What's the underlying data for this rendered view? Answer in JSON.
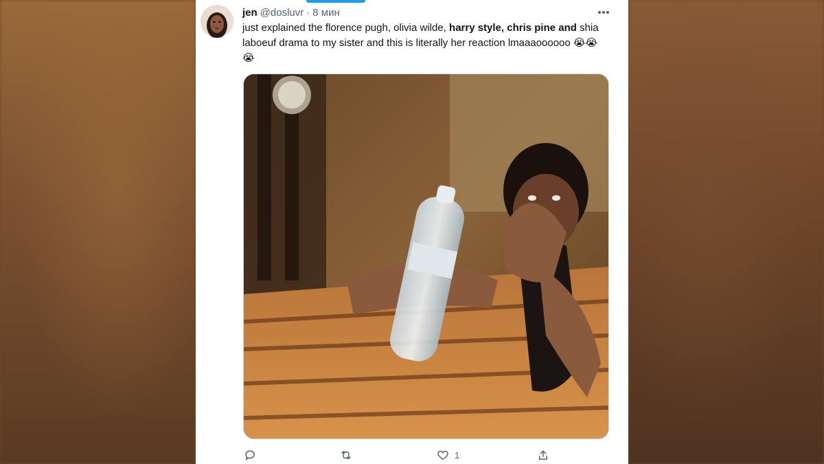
{
  "tweet": {
    "author_name": "jen",
    "author_handle": "@dosluvr",
    "separator": "·",
    "timestamp": "8 мин",
    "text_part1": "just explained the florence pugh, olivia wilde, ",
    "text_bold": "harry style, chris pine and",
    "text_part2": " shia laboeuf drama to my sister and this is literally her reaction lmaaaoooooo ",
    "emojis": "😭😭😭",
    "media_icon": "video-thumbnail"
  },
  "actions": {
    "reply_icon": "reply-icon",
    "retweet_icon": "retweet-icon",
    "like_icon": "heart-icon",
    "like_count": "1",
    "share_icon": "share-icon"
  },
  "colors": {
    "accent": "#1d9bf0",
    "text_primary": "#0f1419",
    "text_secondary": "#536471"
  }
}
